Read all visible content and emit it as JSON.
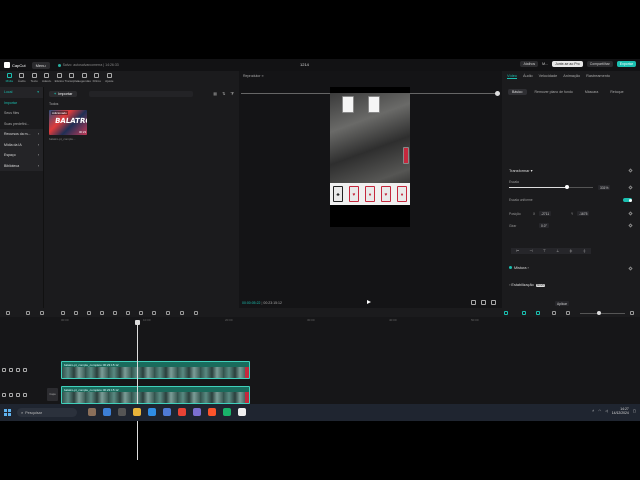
{
  "app": {
    "name": "CapCut",
    "menu_label": "Menu",
    "save_status": "Salvo: autosalvarcomerra | 14:26:33",
    "project_title": "1214",
    "atalhos": "Atalhos",
    "user": "M...",
    "pro_label": "Junte-se ao Pro",
    "share_label": "Compartilhar",
    "export_label": "Exportar"
  },
  "toolbar": {
    "tools": [
      "Mídia",
      "Áudio",
      "Texto",
      "Adesiv.",
      "Efeitos",
      "Transições",
      "Legendas",
      "Filtros",
      "Ajuste"
    ]
  },
  "sidebar": {
    "items": [
      {
        "label": "Local",
        "head": true,
        "active": true
      },
      {
        "label": "Importar",
        "head": false,
        "active": true
      },
      {
        "label": "Seus files",
        "head": false,
        "active": false
      },
      {
        "label": "Suas predefini...",
        "head": false,
        "active": false
      },
      {
        "label": "Recursos da m...",
        "head": true,
        "active": false
      },
      {
        "label": "Mídia da IA",
        "head": true,
        "active": false
      },
      {
        "label": "Espaço",
        "head": true,
        "active": false
      },
      {
        "label": "Biblioteca",
        "head": true,
        "active": false
      }
    ]
  },
  "media": {
    "import_label": "Importar",
    "filter_all": "Todos",
    "thumb_badge": "Adicionado",
    "thumb_title": "BALATRO",
    "thumb_time": "00:23",
    "thumb_name": "balatro-pt_comple..."
  },
  "player": {
    "header": "Reprodutor",
    "time_current": "00:00:05:22",
    "time_total": "00:23:15:12"
  },
  "properties": {
    "tabs": [
      "Vídeo",
      "Áudio",
      "Velocidade",
      "Animação",
      "Rastreamento"
    ],
    "subtabs": [
      "Básico",
      "Remover plano de fundo",
      "Máscara",
      "Retoque"
    ],
    "transform_title": "Transformar",
    "scale_label": "Escala",
    "scale_value": "331%",
    "uniform_scale_label": "Escala uniforme",
    "position_label": "Posição",
    "pos_x_axis": "X",
    "pos_x": "-2711",
    "pos_y_axis": "Y",
    "pos_y": "-1675",
    "rotate_label": "Girar",
    "rotate_value": "0.0°",
    "align_buttons": [
      "⊢",
      "⊣",
      "⊤",
      "⊥",
      "╪",
      "┼"
    ],
    "blend_label": "Mistura",
    "stabilize_label": "Estabilização",
    "new_badge": "NOVO",
    "apply_label": "Aplicar"
  },
  "timeline": {
    "ruler_marks": [
      "00:00",
      "10:00",
      "20:00",
      "30:00",
      "40:00",
      "50:00"
    ],
    "cover_label": "Capa",
    "clips": [
      {
        "label": "balatro-pt_comple_completo  00:23:15:12"
      },
      {
        "label": "balatro-pt_comple_completo  00:23:15:12"
      }
    ]
  },
  "taskbar": {
    "search_placeholder": "Pesquisar",
    "time": "14:27",
    "date": "14/12/2024"
  },
  "colors": {
    "accent": "#1bbfb0",
    "clip": "#1a6b5c",
    "card_red": "#c5283d"
  }
}
